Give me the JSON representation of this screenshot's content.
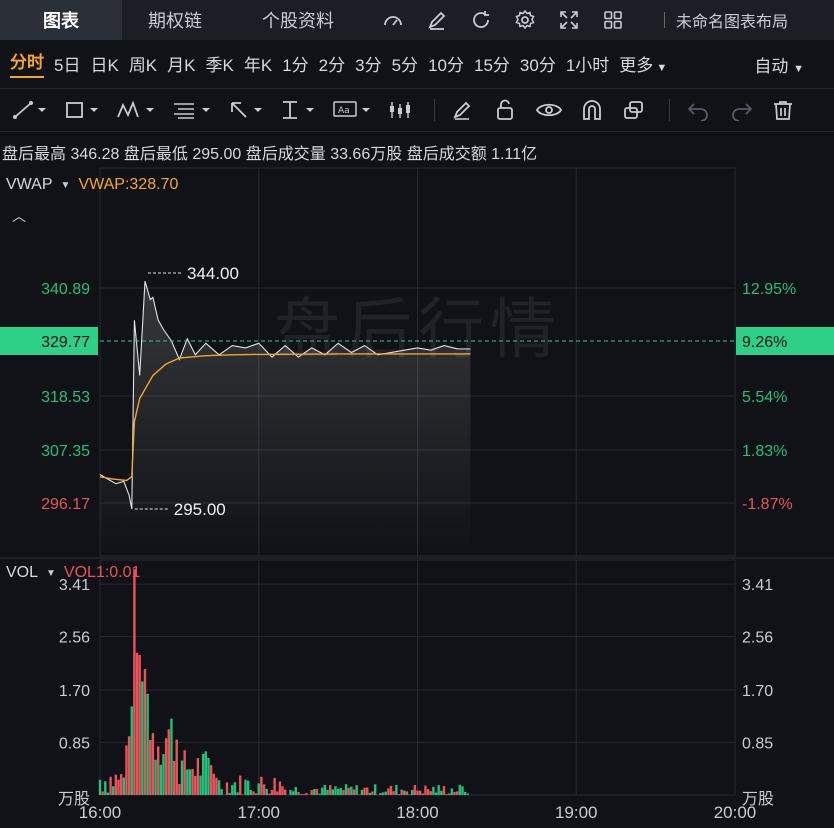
{
  "tabs": [
    {
      "label": "图表",
      "active": true
    },
    {
      "label": "期权链",
      "active": false
    },
    {
      "label": "个股资料",
      "active": false
    }
  ],
  "toolbar_icons": [
    "speed-icon",
    "edit-icon",
    "refresh-icon",
    "gear-icon",
    "fullscreen-icon",
    "grid-icon"
  ],
  "layout_label": "未命名图表布局",
  "periods": [
    "分时",
    "5日",
    "日K",
    "周K",
    "月K",
    "季K",
    "年K",
    "1分",
    "2分",
    "3分",
    "5分",
    "10分",
    "15分",
    "30分",
    "1小时",
    "更多"
  ],
  "active_period": "分时",
  "auto_label": "自动",
  "after_hours": {
    "high_label": "盘后最高",
    "high": "346.28",
    "low_label": "盘后最低",
    "low": "295.00",
    "vol_label": "盘后成交量",
    "vol": "33.66万股",
    "amt_label": "盘后成交额",
    "amt": "1.11亿"
  },
  "indicator_main": {
    "name": "VWAP",
    "value_label": "VWAP:328.70"
  },
  "indicator_vol": {
    "name": "VOL",
    "value_label": "VOL1:0.01"
  },
  "watermark": "盘后行情",
  "colors": {
    "up": "#22c07a",
    "down": "#e9545a",
    "vwap": "#f5a623",
    "price": "#dfe3ea",
    "current": "#2ecf86"
  },
  "chart_data": {
    "type": "line",
    "x_ticks": [
      "16:00",
      "17:00",
      "18:00",
      "19:00",
      "20:00"
    ],
    "x_range": [
      "16:00",
      "20:00"
    ],
    "y_ticks_left": [
      "340.89",
      "329.77",
      "318.53",
      "307.35",
      "296.17"
    ],
    "y_ticks_right": [
      "12.95%",
      "9.26%",
      "5.54%",
      "1.83%",
      "-1.87%"
    ],
    "current_price": "329.77",
    "current_pct": "9.26%",
    "ylim": [
      290,
      350
    ],
    "high_marker": "344.00",
    "low_marker": "295.00",
    "price": {
      "x": [
        "16:00",
        "16:03",
        "16:06",
        "16:09",
        "16:11",
        "16:12",
        "16:13",
        "16:15",
        "16:17",
        "16:19",
        "16:20",
        "16:22",
        "16:24",
        "16:27",
        "16:30",
        "16:33",
        "16:36",
        "16:40",
        "16:45",
        "16:50",
        "16:55",
        "17:00",
        "17:05",
        "17:10",
        "17:15",
        "17:20",
        "17:25",
        "17:30",
        "17:35",
        "17:40",
        "17:45",
        "17:50",
        "17:55",
        "18:00",
        "18:05",
        "18:10",
        "18:15",
        "18:20"
      ],
      "y": [
        302.5,
        301.5,
        300.5,
        301.0,
        298.0,
        295.0,
        336.0,
        324.0,
        344.5,
        340.5,
        341.0,
        336.0,
        334.0,
        331.5,
        327.5,
        332.0,
        328.5,
        331.0,
        328.5,
        330.5,
        330.0,
        331.0,
        328.0,
        330.5,
        328.0,
        330.0,
        328.5,
        331.0,
        329.0,
        330.5,
        328.5,
        329.0,
        329.5,
        330.0,
        329.5,
        330.5,
        329.8,
        329.77
      ]
    },
    "vwap": {
      "x": [
        "16:00",
        "16:05",
        "16:10",
        "16:12",
        "16:13",
        "16:15",
        "16:20",
        "16:25",
        "16:30",
        "16:40",
        "16:50",
        "17:00",
        "17:30",
        "18:00",
        "18:20"
      ],
      "y": [
        302.0,
        301.5,
        301.2,
        302.0,
        314.0,
        319.0,
        324.0,
        326.5,
        327.8,
        328.3,
        328.5,
        328.6,
        328.7,
        328.7,
        328.7
      ]
    },
    "volume": {
      "y_ticks": [
        "3.41",
        "2.56",
        "1.70",
        "0.85"
      ],
      "unit": "万股",
      "ylim": [
        0,
        3.8
      ]
    }
  }
}
